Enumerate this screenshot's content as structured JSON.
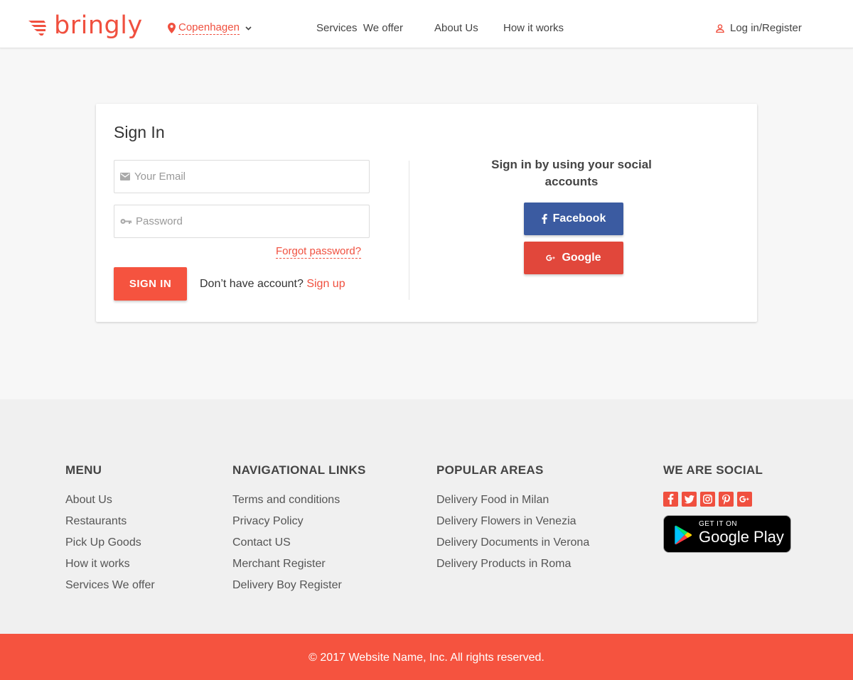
{
  "header": {
    "logo_text": "bringly",
    "location": "Copenhagen",
    "nav": [
      "Services  We offer",
      "About Us",
      "How it works"
    ],
    "login": "Log in/Register"
  },
  "signin": {
    "title": "Sign In",
    "email_placeholder": "Your Email",
    "password_placeholder": "Password",
    "forgot": "Forgot password?",
    "button": "SIGN IN",
    "no_account": "Don’t have account?",
    "signup": "Sign up",
    "social_title": "Sign in by using your social accounts",
    "facebook": "Facebook",
    "google": "Google"
  },
  "footer": {
    "menu": {
      "title": "MENU",
      "items": [
        "About Us",
        "Restaurants",
        "Pick Up Goods",
        "How it works",
        "Services We offer"
      ]
    },
    "navigational": {
      "title": "NAVIGATIONAL LINKS",
      "items": [
        "Terms and conditions",
        "Privacy Policy",
        "Contact US",
        "Merchant Register",
        "Delivery Boy Register"
      ]
    },
    "areas": {
      "title": "POPULAR AREAS",
      "items": [
        "Delivery Food in Milan",
        "Delivery Flowers in Venezia",
        "Delivery Documents in Verona",
        "Delivery Products in Roma"
      ]
    },
    "social": {
      "title": "WE ARE SOCIAL",
      "icons": [
        "facebook-icon",
        "twitter-icon",
        "instagram-icon",
        "pinterest-icon",
        "google-plus-icon"
      ],
      "play_small": "GET IT ON",
      "play_big": "Google Play"
    },
    "copyright": "© 2017 Website Name, Inc. All rights reserved."
  },
  "colors": {
    "accent": "#f5533f",
    "facebook": "#3b5ba1",
    "google": "#e1473b"
  }
}
